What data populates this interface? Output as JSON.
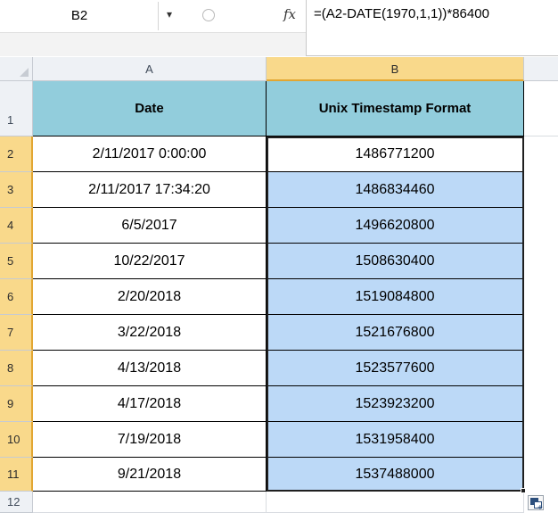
{
  "formula_bar": {
    "name_box": "B2",
    "name_box_arrow": "▾",
    "fx_label": "fx",
    "formula": "=(A2-DATE(1970,1,1))*86400"
  },
  "columns": [
    "A",
    "B"
  ],
  "rows": [
    "1",
    "2",
    "3",
    "4",
    "5",
    "6",
    "7",
    "8",
    "9",
    "10",
    "11",
    "12"
  ],
  "table": {
    "headers": [
      "Date",
      "Unix Timestamp Format"
    ],
    "rows": [
      [
        "2/11/2017 0:00:00",
        "1486771200"
      ],
      [
        "2/11/2017 17:34:20",
        "1486834460"
      ],
      [
        "6/5/2017",
        "1496620800"
      ],
      [
        "10/22/2017",
        "1508630400"
      ],
      [
        "2/20/2018",
        "1519084800"
      ],
      [
        "3/22/2018",
        "1521676800"
      ],
      [
        "4/13/2018",
        "1523577600"
      ],
      [
        "4/17/2018",
        "1523923200"
      ],
      [
        "7/19/2018",
        "1531958400"
      ],
      [
        "9/21/2018",
        "1537488000"
      ]
    ]
  },
  "colors": {
    "header_fill": "#92cddc",
    "selection_fill": "#bcd9f7",
    "active_header": "#f9d98b"
  }
}
